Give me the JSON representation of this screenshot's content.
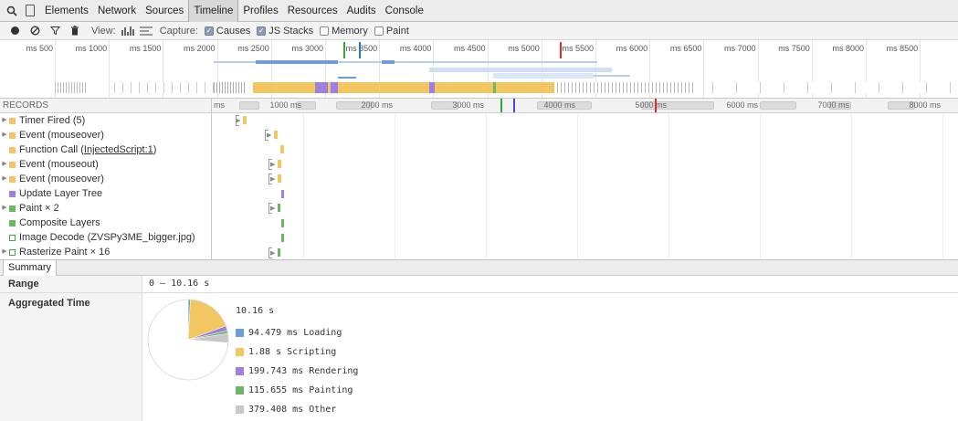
{
  "tabbar": {
    "tabs": [
      {
        "label": "Elements",
        "selected": false
      },
      {
        "label": "Network",
        "selected": false
      },
      {
        "label": "Sources",
        "selected": false
      },
      {
        "label": "Timeline",
        "selected": true
      },
      {
        "label": "Profiles",
        "selected": false
      },
      {
        "label": "Resources",
        "selected": false
      },
      {
        "label": "Audits",
        "selected": false
      },
      {
        "label": "Console",
        "selected": false
      }
    ]
  },
  "toolbar": {
    "view_label": "View:",
    "capture_label": "Capture:",
    "options": [
      {
        "label": "Causes",
        "checked": true
      },
      {
        "label": "JS Stacks",
        "checked": true
      },
      {
        "label": "Memory",
        "checked": false
      },
      {
        "label": "Paint",
        "checked": false
      }
    ]
  },
  "overview": {
    "ticks": [
      "500 ms",
      "1000 ms",
      "1500 ms",
      "2000 ms",
      "2500 ms",
      "3000 ms",
      "3500 ms",
      "4000 ms",
      "4500 ms",
      "5000 ms",
      "5500 ms",
      "6000 ms",
      "6500 ms",
      "7000 ms",
      "7500 ms",
      "8000 ms",
      "8500 ms"
    ]
  },
  "timeline": {
    "header_label": "RECORDS",
    "ms_label": "ms",
    "ticks": [
      "1000 ms",
      "2000 ms",
      "3000 ms",
      "4000 ms",
      "5000 ms",
      "6000 ms",
      "7000 ms",
      "8000 ms"
    ],
    "records": [
      {
        "label": "Timer Fired (5)",
        "category": "scripting",
        "expandable": true
      },
      {
        "label": "Event (mouseover)",
        "category": "scripting",
        "expandable": true
      },
      {
        "label": "Function Call (",
        "link": "InjectedScript:1",
        "suffix": ")",
        "category": "scripting",
        "expandable": false
      },
      {
        "label": "Event (mouseout)",
        "category": "scripting",
        "expandable": true
      },
      {
        "label": "Event (mouseover)",
        "category": "scripting",
        "expandable": true
      },
      {
        "label": "Update Layer Tree",
        "category": "rendering",
        "expandable": false
      },
      {
        "label": "Paint × 2",
        "category": "painting",
        "expandable": true
      },
      {
        "label": "Composite Layers",
        "category": "painting",
        "expandable": false
      },
      {
        "label": "Image Decode (ZVSPy3ME_bigger.jpg)",
        "category": "painting-hollow",
        "expandable": false
      },
      {
        "label": "Rasterize Paint × 16",
        "category": "painting-hollow",
        "expandable": true
      }
    ]
  },
  "summary": {
    "tab_label": "Summary",
    "range_key": "Range",
    "range_value": "0 – 10.16 s",
    "aggregated_key": "Aggregated Time",
    "total": "10.16 s",
    "items": [
      {
        "label": "94.479 ms Loading",
        "color": "#6f9bd6",
        "ms": 94.479
      },
      {
        "label": "1.88 s Scripting",
        "color": "#f2c661",
        "ms": 1880
      },
      {
        "label": "199.743 ms Rendering",
        "color": "#9d7fe0",
        "ms": 199.743
      },
      {
        "label": "115.655 ms Painting",
        "color": "#6cb765",
        "ms": 115.655
      },
      {
        "label": "379.408 ms Other",
        "color": "#c8c8c8",
        "ms": 379.408
      }
    ],
    "idle_ms": 7490
  },
  "colors": {
    "loading": "#6f9bd6",
    "scripting": "#f2c661",
    "rendering": "#9d7fe0",
    "painting": "#6cb765",
    "other": "#c8c8c8",
    "dom_content_loaded": "#1a7bd6",
    "load": "#e02b2b",
    "first_paint": "#37a63a"
  }
}
